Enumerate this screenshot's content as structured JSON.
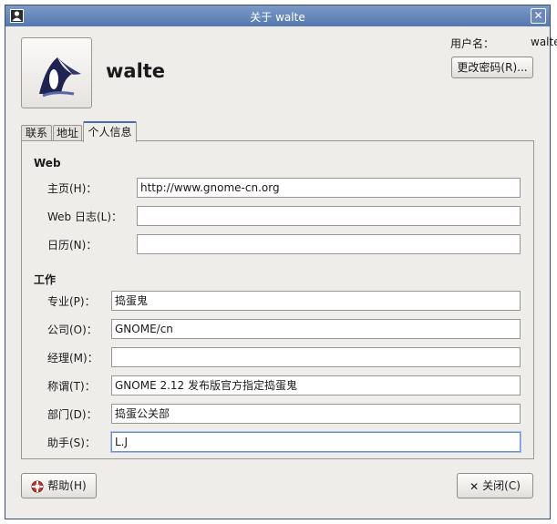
{
  "window": {
    "title": "关于 walte"
  },
  "header": {
    "display_name": "walte",
    "username_label": "用户名：",
    "username_value": "walte",
    "change_password_label": "更改密码(R)..."
  },
  "tabs": [
    {
      "label": "联系",
      "active": false
    },
    {
      "label": "地址",
      "active": false
    },
    {
      "label": "个人信息",
      "active": true
    }
  ],
  "web": {
    "section_title": "Web",
    "fields": [
      {
        "label": "主页(H)：",
        "value": "http://www.gnome-cn.org"
      },
      {
        "label": "Web 日志(L)：",
        "value": ""
      },
      {
        "label": "日历(N)：",
        "value": ""
      }
    ]
  },
  "work": {
    "section_title": "工作",
    "fields": [
      {
        "label": "专业(P)：",
        "value": "捣蛋鬼"
      },
      {
        "label": "公司(O)：",
        "value": "GNOME/cn"
      },
      {
        "label": "经理(M)：",
        "value": ""
      },
      {
        "label": "称谓(T)：",
        "value": "GNOME 2.12 发布版官方指定捣蛋鬼"
      },
      {
        "label": "部门(D)：",
        "value": "捣蛋公关部"
      },
      {
        "label": "助手(S)：",
        "value": "L.J"
      }
    ]
  },
  "footer": {
    "help_label": "帮助(H)",
    "close_label": "关闭(C)"
  },
  "icons": {
    "window": "user-info-icon",
    "photo": "gnome-foot-logo-icon",
    "help": "lifebuoy-help-icon",
    "close": "close-x-icon"
  },
  "colors": {
    "titlebar": "#5b7db5",
    "focus_border": "#6b8fc9"
  }
}
